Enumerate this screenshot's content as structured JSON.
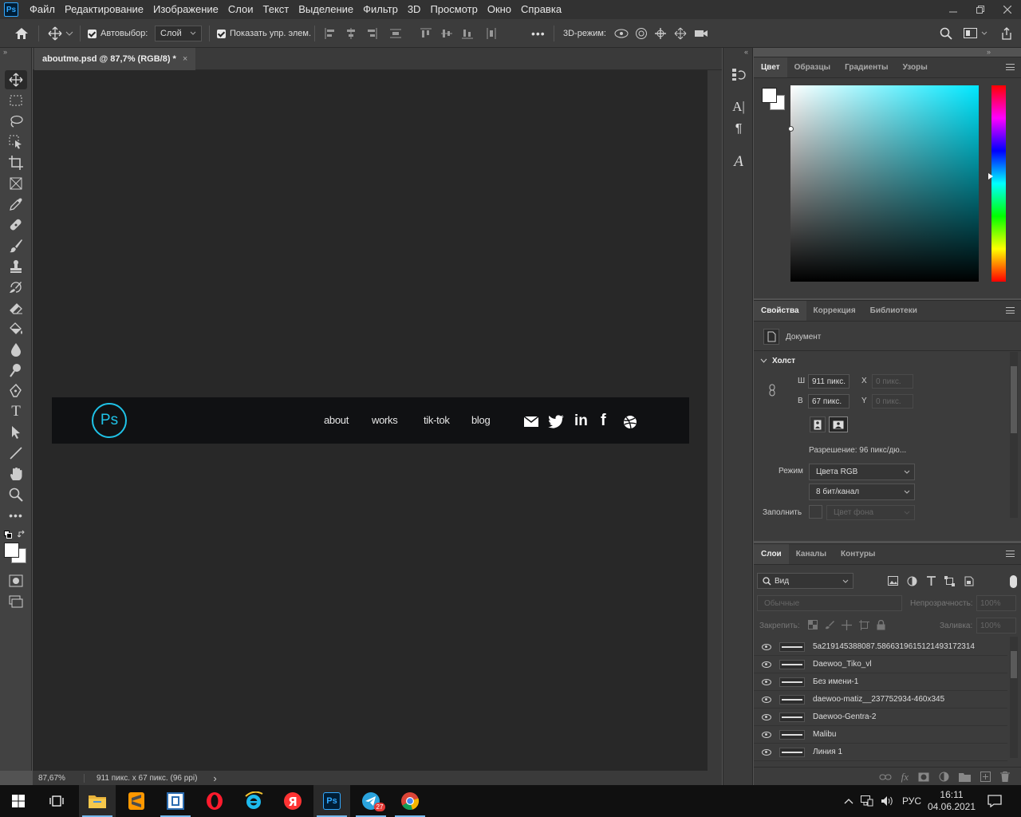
{
  "app": {
    "logo": "Ps",
    "menu": [
      "Файл",
      "Редактирование",
      "Изображение",
      "Слои",
      "Текст",
      "Выделение",
      "Фильтр",
      "3D",
      "Просмотр",
      "Окно",
      "Справка"
    ]
  },
  "options": {
    "autoselect_label": "Автовыбор:",
    "autoselect_value": "Слой",
    "show_controls_label": "Показать упр. элем.",
    "more": "•••",
    "mode_3d_label": "3D-режим:"
  },
  "document": {
    "tab_title": "aboutme.psd @ 87,7% (RGB/8) *",
    "tab_close": "×",
    "zoom": "87,67%",
    "size_info": "911 пикс. x 67 пикс. (96 ppi)",
    "status_arrow": "›"
  },
  "artboard": {
    "logo": "Ps",
    "nav": [
      "about",
      "works",
      "tik-tok",
      "blog"
    ]
  },
  "color_panel": {
    "tabs": [
      "Цвет",
      "Образцы",
      "Градиенты",
      "Узоры"
    ]
  },
  "properties_panel": {
    "tabs": [
      "Свойства",
      "Коррекция",
      "Библиотеки"
    ],
    "doc_label": "Документ",
    "canvas_heading": "Холст",
    "w_label": "Ш",
    "w_value": "911 пикс.",
    "h_label": "В",
    "h_value": "67 пикс.",
    "x_label": "X",
    "x_placeholder": "0 пикс.",
    "y_label": "Y",
    "y_placeholder": "0 пикс.",
    "resolution": "Разрешение: 96 пикс/дю...",
    "mode_label": "Режим",
    "mode_value": "Цвета RGB",
    "depth_value": "8 бит/канал",
    "fill_label": "Заполнить",
    "fill_value": "Цвет фона"
  },
  "layers_panel": {
    "tabs": [
      "Слои",
      "Каналы",
      "Контуры"
    ],
    "filter_value": "Вид",
    "blend_value": "Обычные",
    "opacity_label": "Непрозрачность:",
    "opacity_value": "100%",
    "lock_label": "Закрепить:",
    "fill_label": "Заливка:",
    "fill_value": "100%",
    "layers": [
      "5a219145388087.5866319615121493172314",
      "Daewoo_Tiko_vl",
      "Без имени-1",
      "daewoo-matiz__237752934-460x345",
      "Daewoo-Gentra-2",
      "Malibu",
      "Линия 1"
    ]
  },
  "taskbar": {
    "lang": "РУС",
    "time": "16:11",
    "date": "04.06.2021",
    "telegram_badge": "27",
    "ps_label": "Ps"
  },
  "colors": {
    "accent": "#31a8ff",
    "ps_logo_cyan": "#1fc3e8",
    "canvas_bg": "#282828",
    "artboard_bg": "#101113"
  }
}
